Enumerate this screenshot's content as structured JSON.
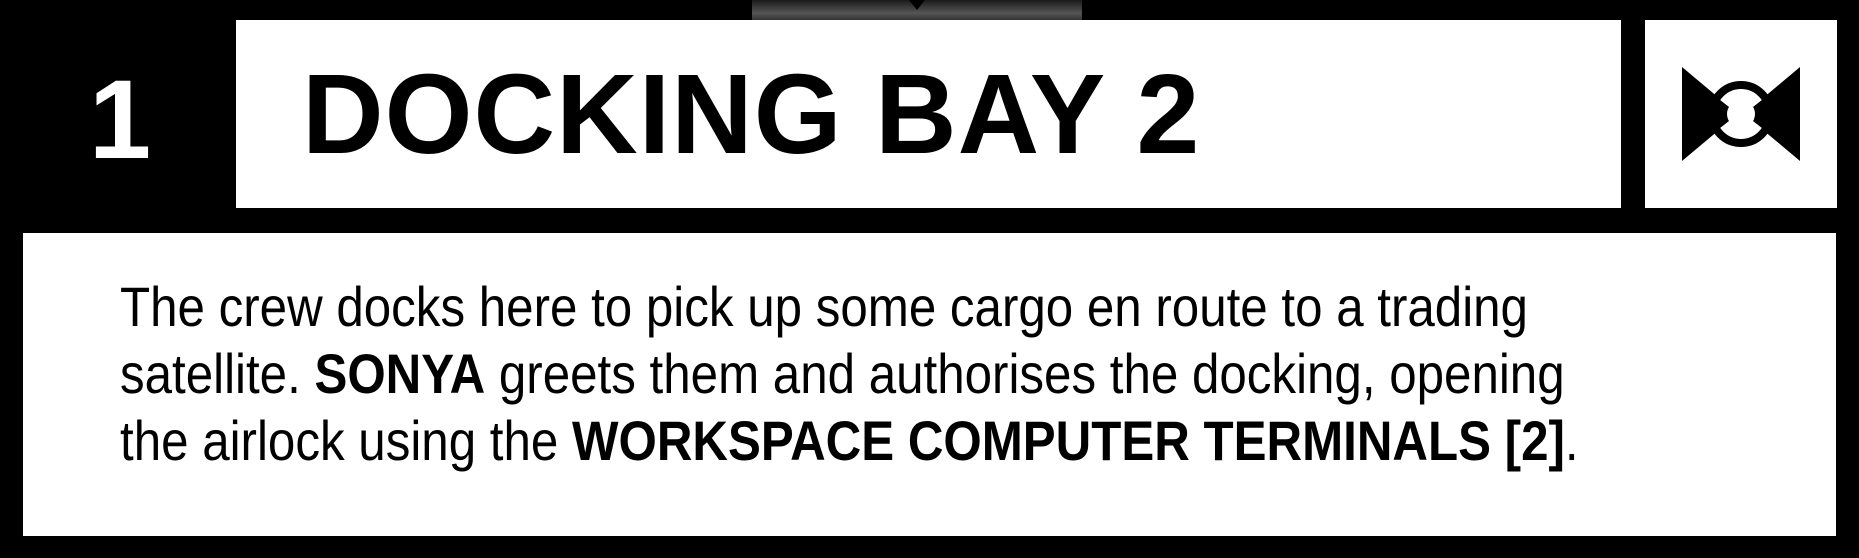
{
  "card": {
    "number": "1",
    "title": "DOCKING BAY 2",
    "icon": "docking-bowtie-icon"
  },
  "body": {
    "line1": "The crew docks here to pick up some cargo en route to a trading",
    "line2_before": "satellite. ",
    "line2_bold": "SONYA",
    "line2_after": " greets them and authorises the docking, opening",
    "line3_before": "the airlock using the ",
    "line3_bold": "WORKSPACE COMPUTER TERMINALS [2]",
    "line3_after": "."
  },
  "colors": {
    "frame": "#000000",
    "panel": "#ffffff",
    "text": "#000000"
  }
}
